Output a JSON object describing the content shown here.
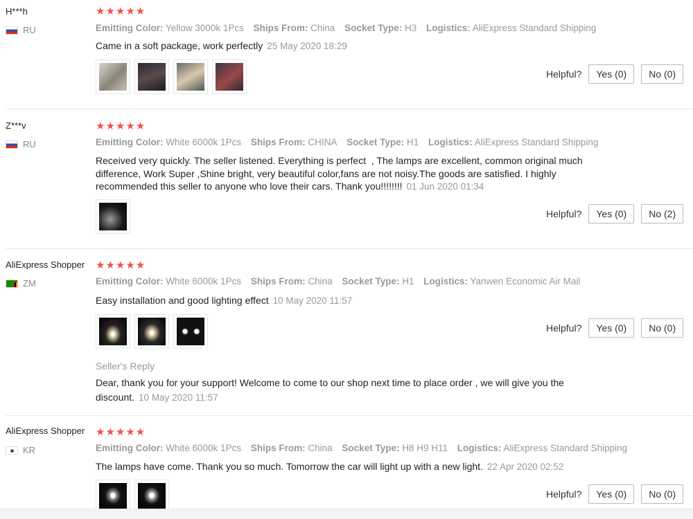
{
  "labels": {
    "emitting_color": "Emitting Color:",
    "ships_from": "Ships From:",
    "socket_type": "Socket Type:",
    "logistics": "Logistics:",
    "helpful": "Helpful?",
    "seller_reply": "Seller's Reply"
  },
  "stars_text": "★★★★★",
  "reviews": [
    {
      "user": "H***h",
      "country": "RU",
      "rating": 5,
      "emitting_color": "Yellow 3000k 1Pcs",
      "ships_from": "China",
      "socket_type": "H3",
      "logistics": "AliExpress Standard Shipping",
      "text": "Came in a soft package, work perfectly",
      "date": "25 May 2020 18:29",
      "yes": "Yes (0)",
      "no": "No (0)"
    },
    {
      "user": "Z***v",
      "country": "RU",
      "rating": 5,
      "emitting_color": "White 6000k 1Pcs",
      "ships_from": "CHINA",
      "socket_type": "H1",
      "logistics": "AliExpress Standard Shipping",
      "text_lines": [
        "Received very quickly. The seller listened. Everything is perfect  , The lamps are excellent, common original much",
        "difference, Work Super ,Shine bright, very beautiful color,fans are not noisy.The goods are satisfied. I highly",
        "recommended this seller to anyone who love their cars. Thank you!!!!!!!!"
      ],
      "date": "01 Jun 2020 01:34",
      "yes": "Yes (0)",
      "no": "No (2)"
    },
    {
      "user": "AliExpress Shopper",
      "country": "ZM",
      "rating": 5,
      "emitting_color": "White 6000k 1Pcs",
      "ships_from": "China",
      "socket_type": "H1",
      "logistics": "Yanwen Economic Air Mail",
      "text": "Easy installation and good lighting effect",
      "date": "10 May 2020 11:57",
      "yes": "Yes (0)",
      "no": "No (0)",
      "reply_lines": [
        "Dear, thank you for your support! Welcome to come to our shop next time to place order , we will give you the",
        "discount."
      ],
      "reply_date": "10 May 2020 11:57"
    },
    {
      "user": "AliExpress Shopper",
      "country": "KR",
      "rating": 5,
      "emitting_color": "White 6000k 1Pcs",
      "ships_from": "China",
      "socket_type": "H8 H9 H11",
      "logistics": "AliExpress Standard Shipping",
      "text": "The lamps have come. Thank you so much. Tomorrow the car will light up with a new light.",
      "date": "22 Apr 2020 02:52",
      "yes": "Yes (0)",
      "no": "No (0)"
    }
  ]
}
